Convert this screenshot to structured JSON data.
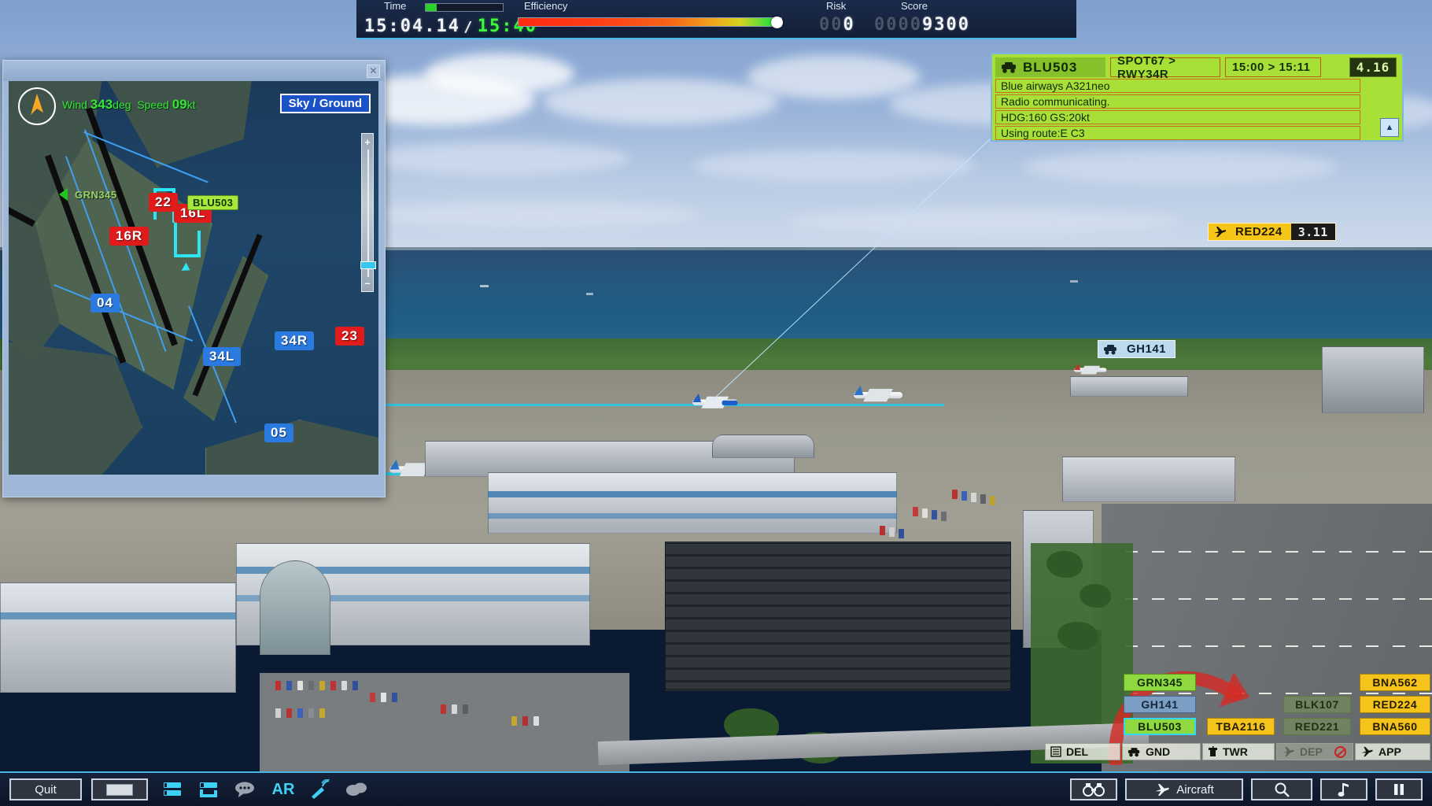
{
  "hud": {
    "time_label": "Time",
    "efficiency_label": "Efficiency",
    "risk_label": "Risk",
    "score_label": "Score",
    "clock_current": "15:04.14",
    "clock_separator": "/",
    "clock_target": "15:40",
    "time_progress_pct": 14,
    "efficiency_pct": 99,
    "risk_lead": "00",
    "risk_value": "0",
    "score_lead": "0000",
    "score_value": "9300",
    "accent_color": "#49b7e8",
    "green_color": "#3dfa3d"
  },
  "map": {
    "close_label": "✕",
    "wind_label": "Wind",
    "wind_value": "343",
    "wind_unit": "deg",
    "speed_label": "Speed",
    "speed_value": "09",
    "speed_unit": "kt",
    "view_toggle": "Sky / Ground",
    "zoom_plus": "+",
    "zoom_minus": "–",
    "runway_tags": [
      {
        "label": "22",
        "color": "red"
      },
      {
        "label": "16L",
        "color": "red"
      },
      {
        "label": "16R",
        "color": "red"
      },
      {
        "label": "04",
        "color": "blue"
      },
      {
        "label": "23",
        "color": "red"
      },
      {
        "label": "34L",
        "color": "blue"
      },
      {
        "label": "34R",
        "color": "blue"
      },
      {
        "label": "05",
        "color": "blue"
      }
    ],
    "aircraft_labels": [
      {
        "label": "GRN345",
        "style": "plain"
      },
      {
        "label": "BLU503",
        "style": "selected"
      }
    ]
  },
  "info_panel": {
    "callsign": "BLU503",
    "route_chip": "SPOT67 > RWY34R",
    "time_chip": "15:00 > 15:11",
    "timer": "4.16",
    "lines": [
      "Blue airways A321neo",
      "Radio communicating.",
      "HDG:160 GS:20kt",
      "Using route:E C3"
    ],
    "collapse_label": "▲",
    "panel_color": "#a8e038"
  },
  "scene_callouts": [
    {
      "label": "RED224",
      "timer": "3.11",
      "style": "yellow",
      "icon": "airplane-icon"
    },
    {
      "label": "GH141",
      "timer": "",
      "style": "lblue",
      "icon": "vehicle-icon"
    }
  ],
  "strip_board": {
    "columns": [
      {
        "tab": "DEL",
        "icon": "strip-list-icon",
        "enabled": true,
        "strips": []
      },
      {
        "tab": "GND",
        "icon": "vehicle-icon",
        "enabled": true,
        "strips": [
          {
            "label": "GRN345",
            "style": "green"
          },
          {
            "label": "GH141",
            "style": "blue"
          },
          {
            "label": "BLU503",
            "style": "greensel"
          }
        ]
      },
      {
        "tab": "TWR",
        "icon": "tower-icon",
        "enabled": true,
        "strips": [
          {
            "label": "TBA2116",
            "style": "yellow"
          }
        ]
      },
      {
        "tab": "DEP",
        "icon": "departure-icon",
        "enabled": false,
        "strips": [
          {
            "label": "BLK107",
            "style": "dim"
          },
          {
            "label": "RED221",
            "style": "dim"
          }
        ]
      },
      {
        "tab": "APP",
        "icon": "approach-icon",
        "enabled": true,
        "strips": [
          {
            "label": "BNA562",
            "style": "yellow"
          },
          {
            "label": "RED224",
            "style": "yellow"
          },
          {
            "label": "BNA560",
            "style": "yellow"
          }
        ]
      }
    ]
  },
  "toolbar": {
    "quit_label": "Quit",
    "window_label": "",
    "ar_label": "AR",
    "aircraft_label": "Aircraft",
    "left_icons": [
      "strips-icon",
      "route-icon",
      "chat-icon",
      "ar-label",
      "radar-dish-icon",
      "weather-cloud-icon"
    ],
    "right_icons": [
      "binoculars-icon",
      "aircraft-button",
      "search-icon",
      "music-icon",
      "pause-icon"
    ]
  }
}
